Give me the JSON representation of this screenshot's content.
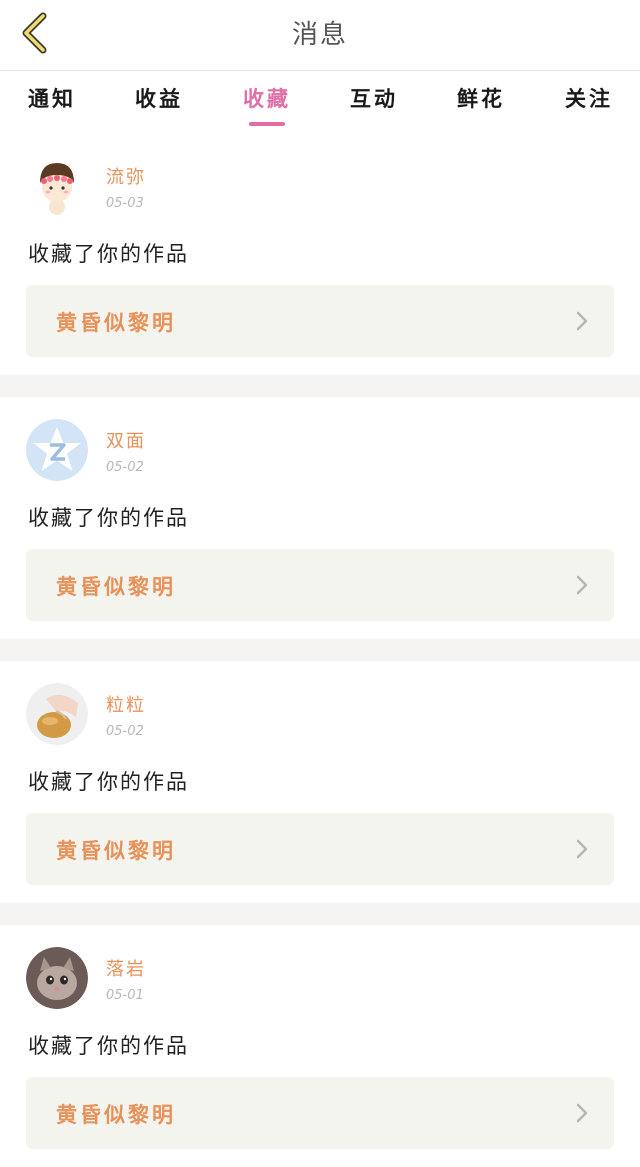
{
  "header": {
    "title": "消息"
  },
  "tabs": [
    {
      "label": "通知"
    },
    {
      "label": "收益"
    },
    {
      "label": "收藏"
    },
    {
      "label": "互动"
    },
    {
      "label": "鲜花"
    },
    {
      "label": "关注"
    }
  ],
  "active_tab": "收藏",
  "colors": {
    "accent": "#e06fa8",
    "name_color": "#e8925a",
    "card_bg": "#f4f4ee",
    "separator": "#f6f3f3"
  },
  "feed": [
    {
      "name": "流弥",
      "date": "05-03",
      "action": "收藏了你的作品",
      "work_title": "黄昏似黎明",
      "avatar": "cartoon-girl-avatar"
    },
    {
      "name": "双面",
      "date": "05-02",
      "action": "收藏了你的作品",
      "work_title": "黄昏似黎明",
      "avatar": "default-star-avatar"
    },
    {
      "name": "粒粒",
      "date": "05-02",
      "action": "收藏了你的作品",
      "work_title": "黄昏似黎明",
      "avatar": "hand-food-photo-avatar"
    },
    {
      "name": "落岩",
      "date": "05-01",
      "action": "收藏了你的作品",
      "work_title": "黄昏似黎明",
      "avatar": "cat-photo-avatar"
    }
  ]
}
